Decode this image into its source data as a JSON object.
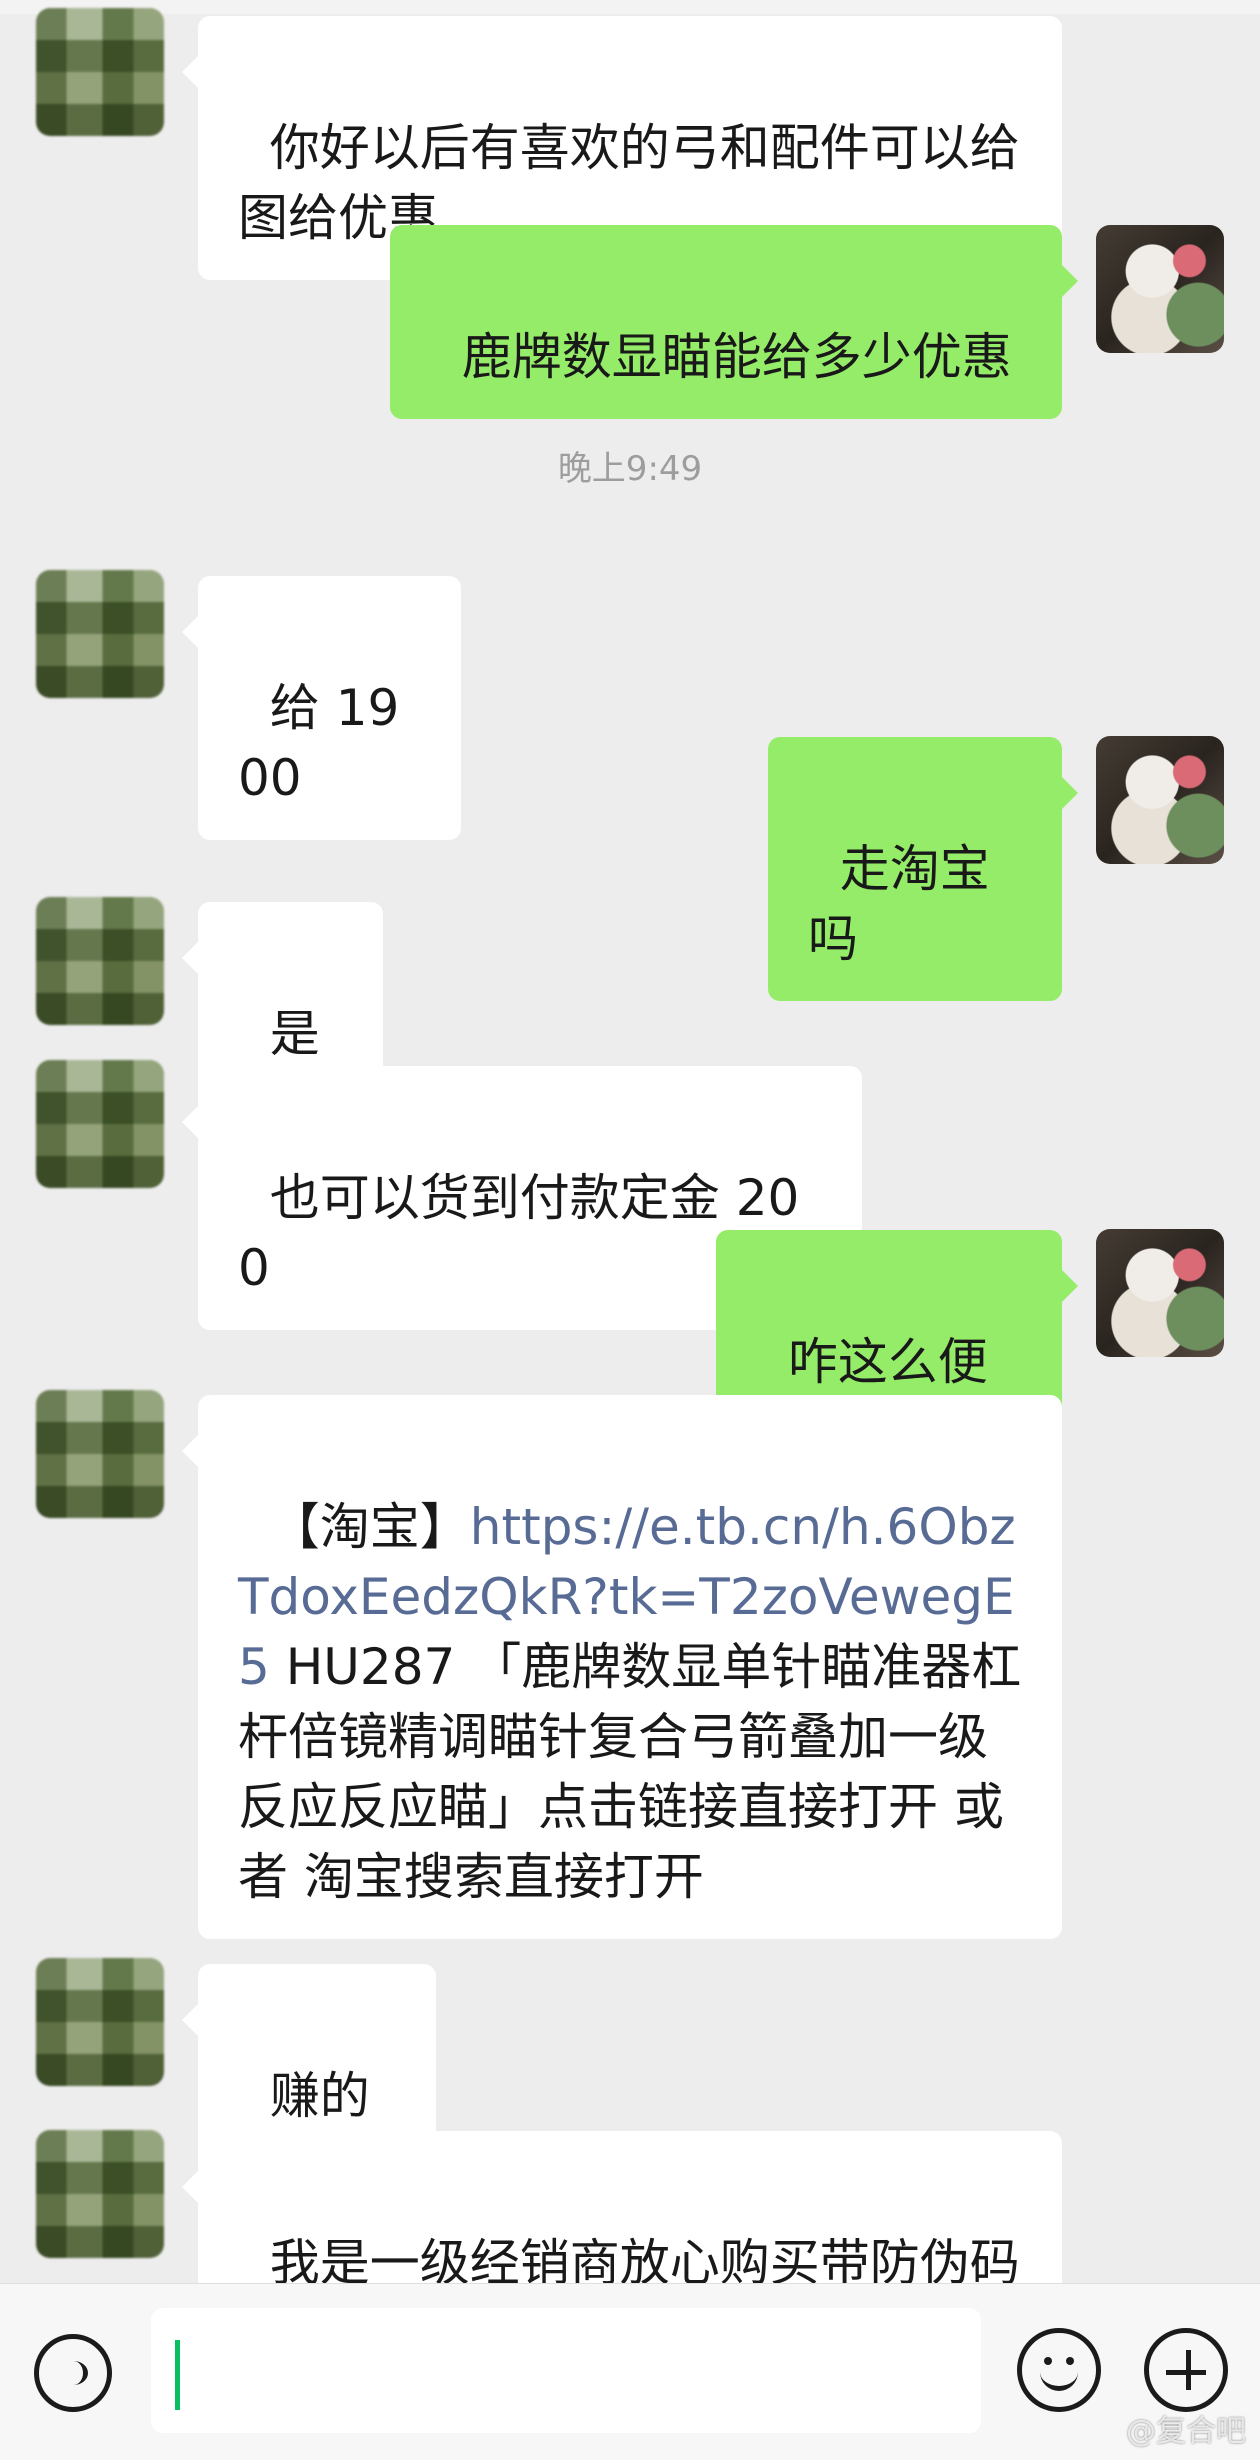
{
  "chat": {
    "timestamp": "晚上9:49",
    "messages": [
      {
        "side": "left",
        "text": "你好以后有喜欢的弓和配件可以给图给优惠"
      },
      {
        "side": "right",
        "text": "鹿牌数显瞄能给多少优惠"
      },
      {
        "side": "left",
        "text": "给 1900"
      },
      {
        "side": "right",
        "text": "走淘宝吗"
      },
      {
        "side": "left",
        "text": "是的"
      },
      {
        "side": "left",
        "text": "也可以货到付款定金 200"
      },
      {
        "side": "right",
        "text": "咋这么便宜"
      },
      {
        "side": "left",
        "prefix": "【淘宝】",
        "link": "https://e.tb.cn/h.6ObzTdoxEedzQkR?tk=T2zoVewegE5",
        "suffix": " HU287 「鹿牌数显单针瞄准器杠杆倍镜精调瞄针复合弓箭叠加一级反应反应瞄」点击链接直接打开 或者 淘宝搜索直接打开"
      },
      {
        "side": "left",
        "text": "赚的少"
      },
      {
        "side": "left",
        "text": "我是一级经销商放心购买带防伪码"
      }
    ]
  },
  "composer": {
    "input_value": ""
  },
  "watermark": "@复合吧",
  "colors": {
    "left_bubble": "#ffffff",
    "right_bubble": "#95ec69",
    "background": "#ededed",
    "link": "#576b95"
  }
}
